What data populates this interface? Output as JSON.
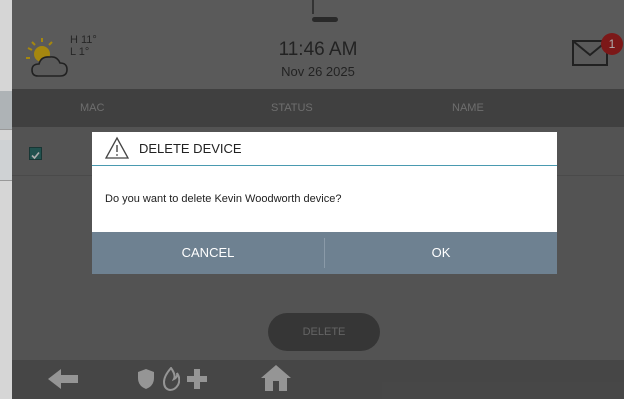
{
  "header": {
    "weather_icon": "partly-cloudy-icon",
    "high": "H 11°",
    "low": "L 1°",
    "time": "11:46 AM",
    "date": "Nov 26 2025",
    "mail_icon": "envelope-icon",
    "unread_count": "1"
  },
  "table": {
    "columns": [
      "MAC",
      "STATUS",
      "NAME"
    ]
  },
  "dialog": {
    "icon": "warning-icon",
    "title": "DELETE DEVICE",
    "message": "Do you want to delete Kevin Woodworth device?",
    "cancel_label": "CANCEL",
    "ok_label": "OK"
  },
  "actions": {
    "delete_label": "DELETE"
  },
  "footer": {
    "icons": [
      "back-arrow-icon",
      "shield-icon",
      "fire-icon",
      "medical-cross-icon",
      "home-icon"
    ]
  },
  "colors": {
    "accent_button_bar": "#6e8191",
    "badge": "#b01010",
    "checkbox": "#1e6b66"
  }
}
